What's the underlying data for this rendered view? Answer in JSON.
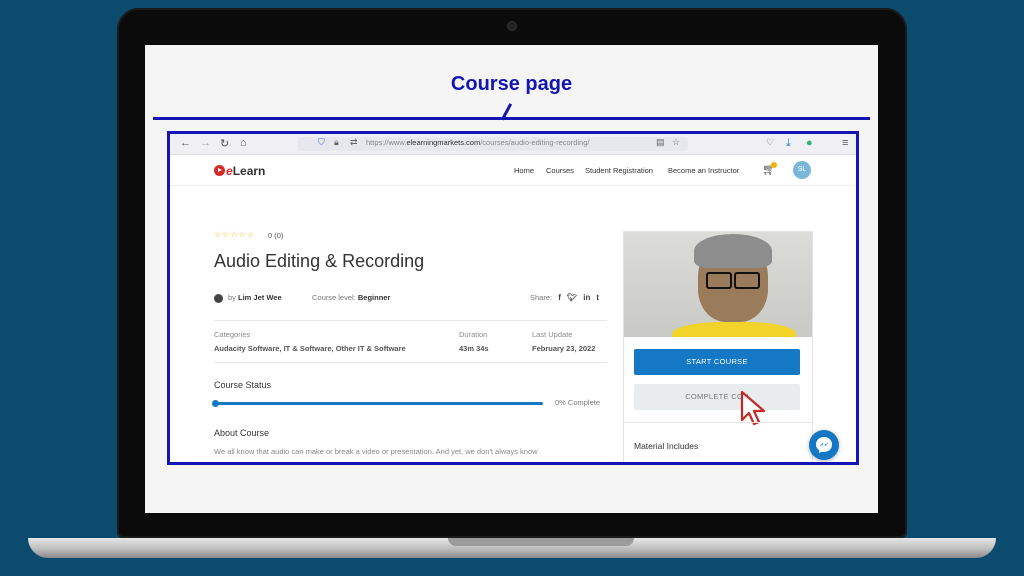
{
  "annotation": {
    "title": "Course page"
  },
  "browser": {
    "url_prefix": "https://www.",
    "url_domain": "elearningmarkets.com",
    "url_path": "/courses/audio-editing-recording/"
  },
  "site": {
    "logo_e": "e",
    "logo_rest": "Learn",
    "nav": [
      "Home",
      "Courses",
      "Student Registration",
      "Become an Instructor"
    ],
    "avatar_initials": "SL"
  },
  "course": {
    "stars": "☆☆☆☆☆",
    "rating": "0 (0)",
    "title": "Audio Editing & Recording",
    "instructor_prefix": "by",
    "instructor": "Lim Jet Wee",
    "level_label": "Course level:",
    "level": "Beginner",
    "share_label": "Share:",
    "categories_label": "Categories",
    "categories": "Audacity Software, IT & Software, Other IT & Software",
    "duration_label": "Duration",
    "duration": "43m 34s",
    "last_update_label": "Last Update",
    "last_update": "February 23, 2022",
    "status_label": "Course Status",
    "progress_percent": 0,
    "progress_text": "0% Complete",
    "about_label": "About Course",
    "about_text": "We all know that audio can make or break a video or presentation. And yet, we don't always know"
  },
  "sidebar": {
    "start_button": "START COURSE",
    "complete_button": "COMPLETE COU",
    "material_label": "Material Includes"
  },
  "colors": {
    "annotation": "#1515b5",
    "primary": "#1478c4",
    "star": "#f3b400",
    "logo_red": "#d62b2b"
  }
}
